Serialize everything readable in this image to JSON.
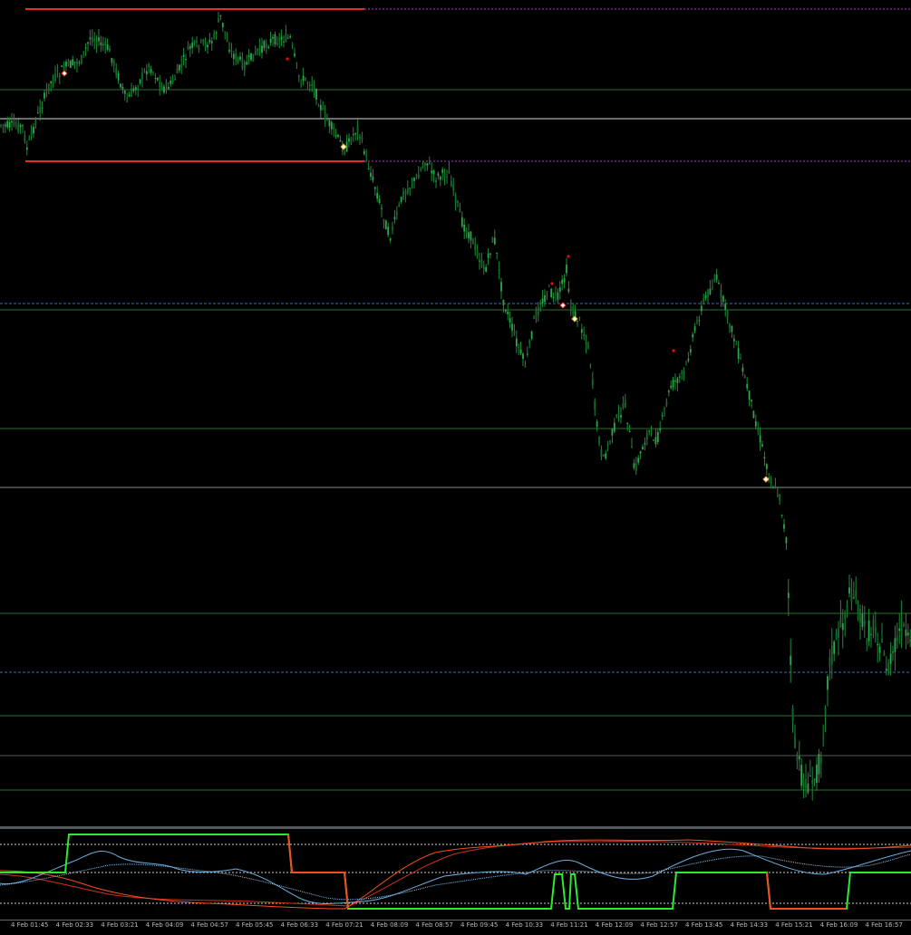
{
  "colors": {
    "background": "#000000",
    "candle": "#1f8a3a",
    "level_red": "#e0301e",
    "level_magenta": "#b03ad0",
    "level_green": "#2e6f2e",
    "level_white": "#d8d8d8",
    "level_dashed_blue": "#3a6fb0",
    "osc_green": "#2ee82e",
    "osc_orange": "#f05020",
    "osc_blue": "#6aaee0",
    "osc_red": "#d03020"
  },
  "markers": {
    "icon": "diamond-icon",
    "dot_color": "#e01010"
  },
  "time_axis": {
    "labels": [
      "4 Feb 01:45",
      "4 Feb 02:33",
      "4 Feb 03:21",
      "4 Feb 04:09",
      "4 Feb 04:57",
      "4 Feb 05:45",
      "4 Feb 06:33",
      "4 Feb 07:21",
      "4 Feb 08:09",
      "4 Feb 08:57",
      "4 Feb 09:45",
      "4 Feb 10:33",
      "4 Feb 11:21",
      "4 Feb 12:09",
      "4 Feb 12:57",
      "4 Feb 13:45",
      "4 Feb 14:33",
      "4 Feb 15:21",
      "4 Feb 16:09",
      "4 Feb 16:57"
    ]
  }
}
